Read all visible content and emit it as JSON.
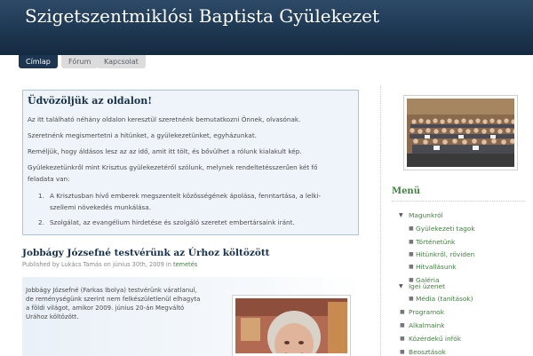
{
  "header": {
    "title": "Szigetszentmiklósi Baptista Gyülekezet"
  },
  "nav": {
    "tabs": [
      "Címlap",
      "Fórum",
      "Kapcsolat"
    ]
  },
  "welcome": {
    "title": "Üdvözöljük az oldalon!",
    "paragraphs": [
      "Az itt található néhány oldalon keresztül szeretnénk bemutatkozni Önnek, olvasónak.",
      "Szeretnénk megismertetni a hitünket, a gyülekezetünket, egyházunkat.",
      "Reméljük, hogy áldásos lesz az az idő, amit itt tölt, és bővülhet a rólunk kialakult kép.",
      "Gyülekezetünkről mint Krisztus gyülekezetéről szólunk, melynek rendeltetésszerűen két fő",
      "feladata van:"
    ],
    "list": [
      {
        "num": "1.",
        "lines": [
          "A Krisztusban hívő emberek megszentelt közösségének ápolása, fenntartása, a lelki-",
          "szellemi növekedés munkálása."
        ]
      },
      {
        "num": "2.",
        "lines": [
          "Szolgálat, az evangélium hirdetése és szolgáló szeretet embertársaink iránt."
        ]
      }
    ]
  },
  "post": {
    "title": "Jobbágy Józsefné testvérünk az Úrhoz költözött",
    "meta_prefix": "Published by Lukács Tamás on június 30th, 2009 in",
    "meta_category": "temetés",
    "body": [
      "Jobbágy Józsefné (Farkas Ibolya) testvérünk váratlanul,",
      "de reménységünk szerint nem felkészületlenül elhagyta",
      "a földi világot, amikor 2009. június 20-án Megváltó",
      "Urához költözött."
    ]
  },
  "sidebar": {
    "menu_title": "Menü",
    "menu": [
      {
        "label": "Magunkról",
        "expanded": true,
        "children": [
          "Gyülekezeti tagok",
          "Történetünk",
          "Hitünkről, röviden",
          "Hitvallásunk",
          "Galéria"
        ]
      },
      {
        "label": "Igei üzenet",
        "expanded": true,
        "children": [
          "Média (tanítások)"
        ]
      },
      {
        "label": "Programok",
        "expanded": false,
        "children": []
      },
      {
        "label": "Alkalmaink",
        "expanded": false,
        "children": []
      },
      {
        "label": "Közérdekű infók",
        "expanded": false,
        "children": []
      },
      {
        "label": "Beosztások",
        "expanded": false,
        "children": []
      }
    ]
  },
  "colors": {
    "header": "#1e3852",
    "accent_green": "#3f7f3f",
    "box_border": "#a9c4dc",
    "box_bg": "#eef4fa"
  },
  "icons": {
    "expanded_marker": "triangle-down-icon",
    "bullet": "bullet-icon"
  }
}
